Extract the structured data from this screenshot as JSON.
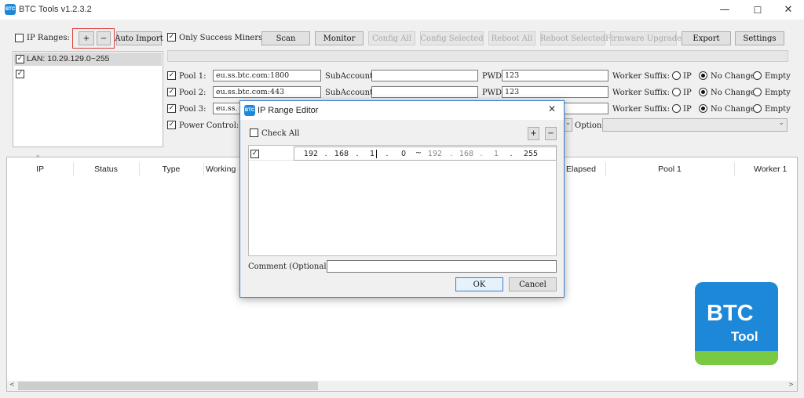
{
  "window": {
    "title": "BTC Tools v1.2.3.2",
    "app_icon_text": "BTC",
    "minimize": "—",
    "maximize": "☐",
    "close": "✕"
  },
  "toolbar": {
    "ip_ranges_label": "IP Ranges:",
    "add": "+",
    "remove": "−",
    "auto_import": "Auto Import",
    "only_success_label": "Only Success Miners",
    "scan": "Scan",
    "monitor": "Monitor",
    "config_all": "Config All",
    "config_selected": "Config Selected",
    "reboot_all": "Reboot All",
    "reboot_selected": "Reboot Selected",
    "firmware_upgrade": "Firmware Upgrade",
    "export": "Export",
    "settings": "Settings"
  },
  "ranges": [
    {
      "label": "LAN: 10.29.129.0~255",
      "checked": true
    },
    {
      "label": "",
      "checked": true
    }
  ],
  "pools": {
    "subaccount_label": "SubAccount:",
    "pwd_label": "PWD:",
    "worker_suffix_label": "Worker Suffix:",
    "opt_ip": "IP",
    "opt_nochange": "No Change",
    "opt_empty": "Empty",
    "rows": [
      {
        "label": "Pool 1:",
        "url": "eu.ss.btc.com:1800",
        "subaccount": "",
        "pwd": "123",
        "suffix": "No Change"
      },
      {
        "label": "Pool 2:",
        "url": "eu.ss.btc.com:443",
        "subaccount": "",
        "pwd": "123",
        "suffix": "No Change"
      },
      {
        "label": "Pool 3:",
        "url": "eu.ss.",
        "subaccount": "",
        "pwd": "",
        "suffix": "No Change"
      }
    ],
    "power_control_label": "Power Control:",
    "option_label": "Option"
  },
  "table": {
    "sort_indicator": "^",
    "columns": [
      "IP",
      "Status",
      "Type",
      "Working",
      "Elapsed",
      "Pool 1",
      "Worker 1"
    ]
  },
  "dialog": {
    "title": "IP Range Editor",
    "check_all": "Check All",
    "add": "+",
    "remove": "−",
    "range": {
      "checked": true,
      "start": [
        "192",
        "168",
        "1",
        "0"
      ],
      "separator": "~",
      "end": [
        "192",
        "168",
        "1",
        "255"
      ]
    },
    "comment_label": "Comment (Optional):",
    "comment_value": "",
    "ok": "OK",
    "cancel": "Cancel",
    "close": "✕"
  },
  "logo": {
    "line1": "BTC",
    "line2": "Tool",
    "bg": "#1e88d8",
    "accent": "#7ac943"
  },
  "scrollbar": {
    "left": "<",
    "right": ">"
  }
}
